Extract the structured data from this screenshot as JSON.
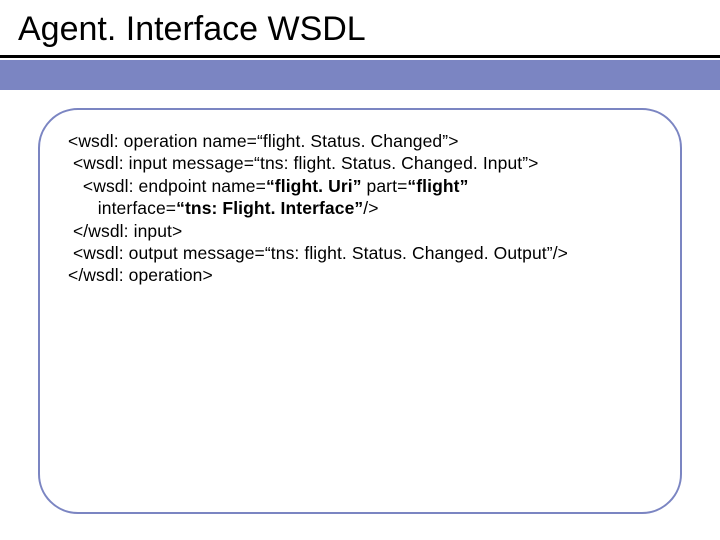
{
  "title": "Agent. Interface WSDL",
  "code": {
    "line1": "<wsdl: operation name=“flight. Status. Changed”>",
    "line2": " <wsdl: input message=“tns: flight. Status. Changed. Input”>",
    "line3a": "   <wsdl: endpoint name=",
    "line3b": "“flight. Uri”",
    "line3c": " part=",
    "line3d": "“flight”",
    "line4a": "      interface=",
    "line4b": "“tns: Flight. Interface”",
    "line4c": "/>",
    "line5": " </wsdl: input>",
    "line6": " <wsdl: output message=“tns: flight. Status. Changed. Output”/>",
    "line7": "</wsdl: operation>"
  },
  "colors": {
    "accent": "#7b85c2"
  }
}
